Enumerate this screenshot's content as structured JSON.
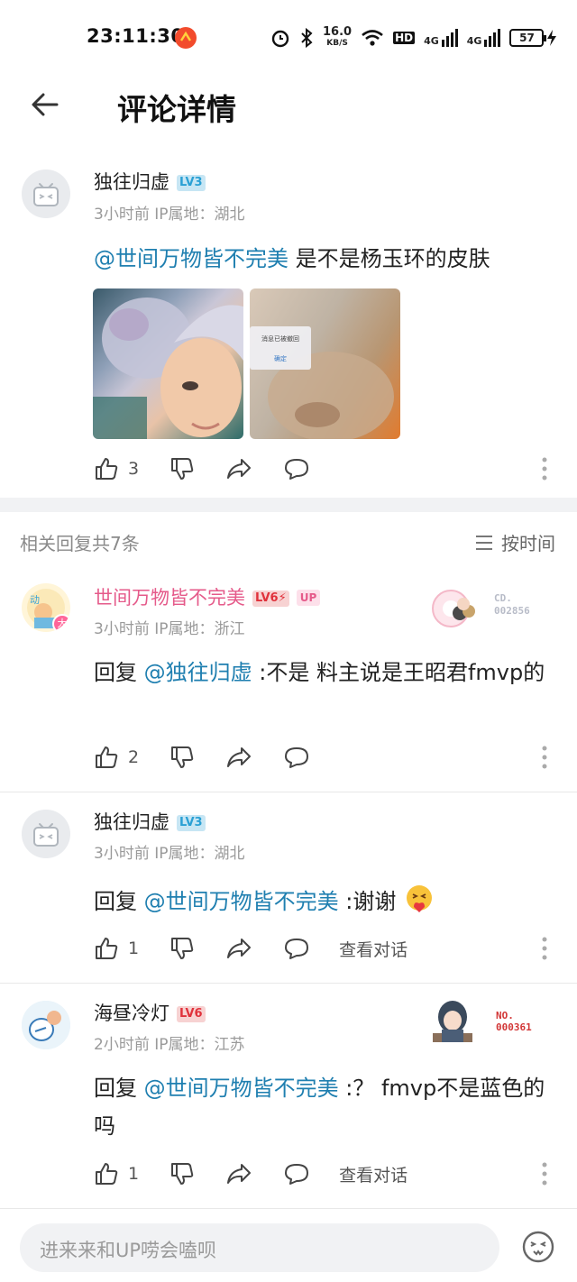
{
  "status_bar": {
    "time": "23:11:30",
    "net_speed_top": "16.0",
    "net_speed_unit": "KB/S",
    "hd": "HD",
    "signal1": "4G",
    "signal2": "4G",
    "battery": "57"
  },
  "header": {
    "title": "评论详情"
  },
  "main_comment": {
    "username": "独往归虚",
    "level": "LV3",
    "meta": "3小时前 IP属地：湖北",
    "mention": "@世间万物皆不完美",
    "text": " 是不是杨玉环的皮肤",
    "image2_dialog_line1": "消息已被撤回",
    "image2_dialog_line2": "确定",
    "likes": "3"
  },
  "replies_header": {
    "count_label": "相关回复共7条",
    "sort_label": "按时间"
  },
  "replies": [
    {
      "username": "世间万物皆不完美",
      "level": "LV6⚡",
      "badge": "UP",
      "avatar_badge": "大",
      "fan_label": "CD.\n002856",
      "meta": "3小时前 IP属地：浙江",
      "prefix": "回复 ",
      "mention": "@独往归虚",
      "text": " :不是 料主说是王昭君fmvp的",
      "likes": "2"
    },
    {
      "username": "独往归虚",
      "level": "LV3",
      "meta": "3小时前 IP属地：湖北",
      "prefix": "回复 ",
      "mention": "@世间万物皆不完美",
      "text": " :谢谢 ",
      "likes": "1",
      "view_conversation": "查看对话"
    },
    {
      "username": "海昼冷灯",
      "level": "LV6",
      "fan_label": "NO.\n000361",
      "meta": "2小时前 IP属地：江苏",
      "prefix": "回复 ",
      "mention": "@世间万物皆不完美",
      "text": " :？ fmvp不是蓝色的吗",
      "likes": "1",
      "view_conversation": "查看对话"
    }
  ],
  "input_bar": {
    "placeholder": "进来来和UP唠会嗑呗"
  },
  "colors": {
    "link": "#1f7fb0",
    "up_name": "#e55a8a",
    "lv3": "#2aa0d4",
    "lv6": "#e0313b"
  }
}
